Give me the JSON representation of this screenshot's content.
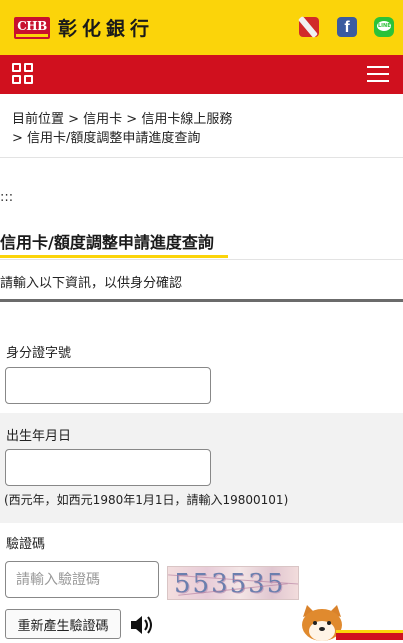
{
  "header": {
    "logo_abbr": "CHB",
    "logo_name": "彰化銀行"
  },
  "social": [
    "instagram-icon",
    "facebook-icon",
    "line-icon"
  ],
  "nav": {
    "grid_icon": "grid-icon",
    "menu_icon": "hamburger-icon"
  },
  "breadcrumb": {
    "line1": "目前位置 > 信用卡 > 信用卡線上服務",
    "line2": "> 信用卡/額度調整申請進度查詢"
  },
  "skip_link": ":::",
  "page": {
    "title": "信用卡/額度調整申請進度查詢",
    "intro": "請輸入以下資訊，以供身分確認"
  },
  "form": {
    "id_label": "身分證字號",
    "id_value": "",
    "birth_label": "出生年月日",
    "birth_value": "",
    "birth_hint": "(西元年，如西元1980年1月1日，請輸入19800101)",
    "captcha_label": "驗證碼",
    "captcha_placeholder": "請輸入驗證碼",
    "captcha_code": "553535",
    "regen_label": "重新產生驗證碼"
  },
  "colors": {
    "brand_yellow": "#fbd40a",
    "brand_red": "#d0101e"
  }
}
